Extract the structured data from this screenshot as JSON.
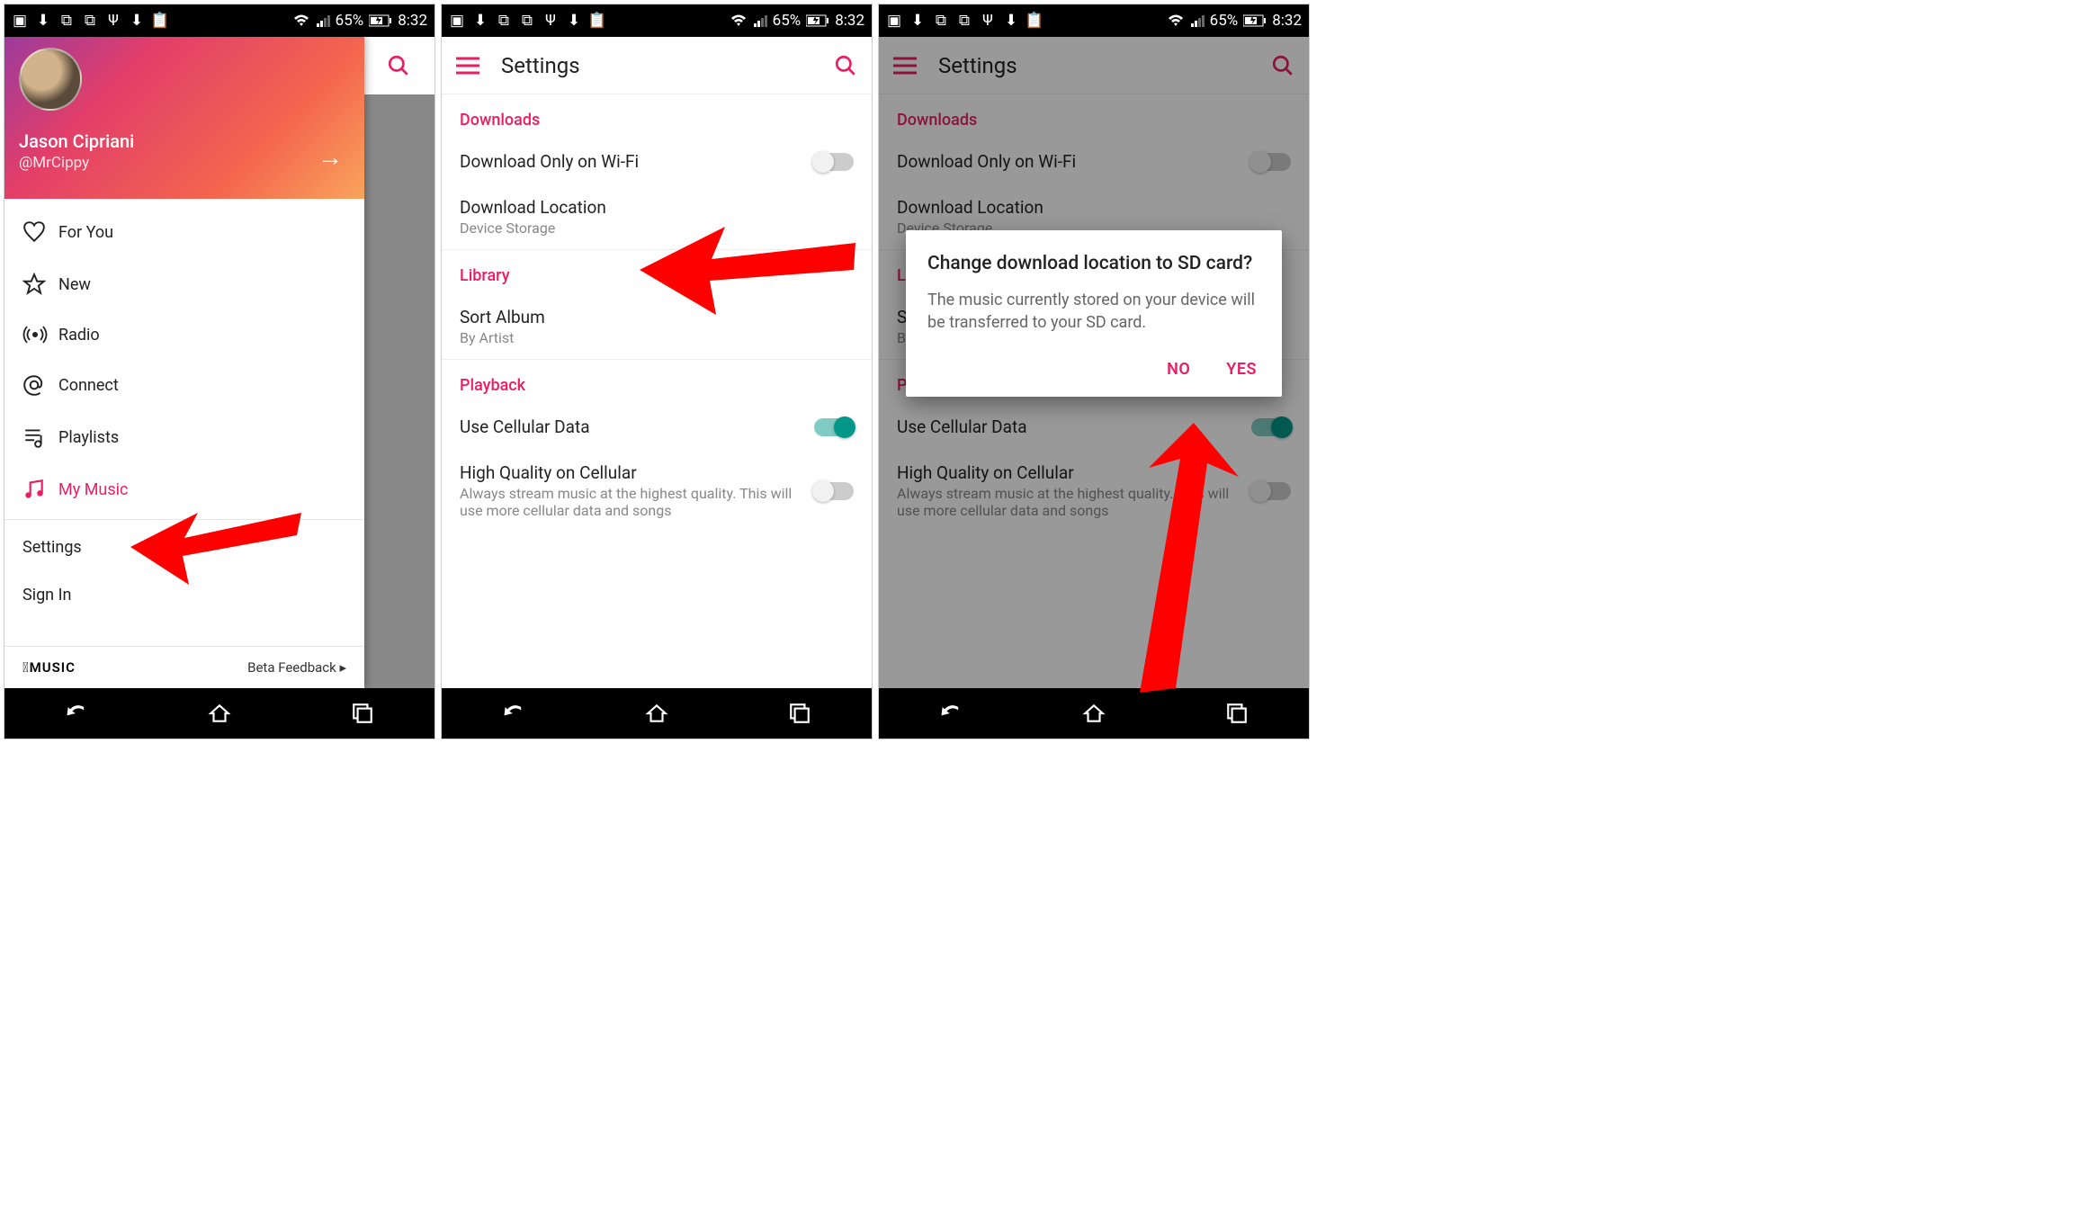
{
  "status_bar": {
    "battery_pct": "65%",
    "time": "8:32"
  },
  "screen1": {
    "user_name": "Jason Cipriani",
    "user_handle": "@MrCippy",
    "nav": {
      "for_you": "For You",
      "new": "New",
      "radio": "Radio",
      "connect": "Connect",
      "playlists": "Playlists",
      "my_music": "My Music"
    },
    "settings": "Settings",
    "sign_in": "Sign In",
    "brand": "MUSIC",
    "beta": "Beta Feedback ▸"
  },
  "settings_screen": {
    "title": "Settings",
    "sections": {
      "downloads": "Downloads",
      "library": "Library",
      "playback": "Playback"
    },
    "items": {
      "wifi_only": "Download Only on Wi-Fi",
      "dl_location": "Download Location",
      "dl_location_sub": "Device Storage",
      "sort_album": "Sort Album",
      "sort_album_sub": "By Artist",
      "cellular": "Use Cellular Data",
      "hq": "High Quality on Cellular",
      "hq_sub": "Always stream music at the highest quality. This will use more cellular data and songs"
    }
  },
  "dialog": {
    "title": "Change download location to SD card?",
    "message": "The music currently stored on your device will be transferred to your SD card.",
    "no": "NO",
    "yes": "YES"
  }
}
